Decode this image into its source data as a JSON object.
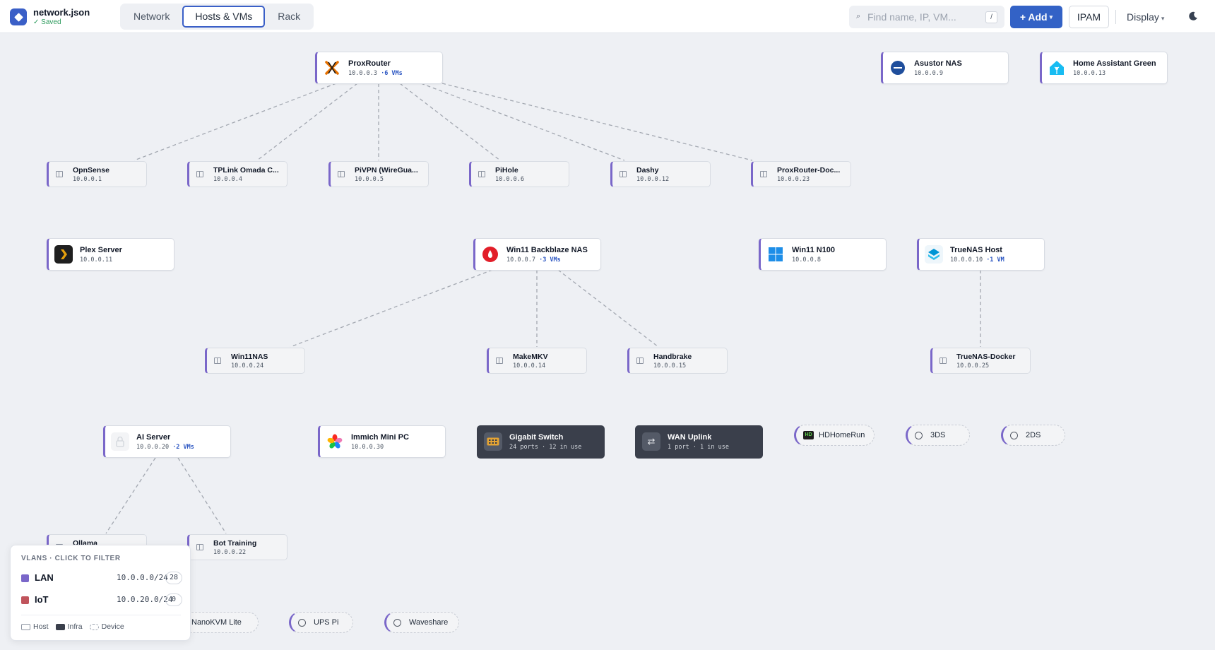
{
  "app": {
    "file_name": "network.json",
    "save_status": "✓ Saved"
  },
  "tabs": [
    {
      "label": "Network",
      "active": false
    },
    {
      "label": "Hosts & VMs",
      "active": true
    },
    {
      "label": "Rack",
      "active": false
    }
  ],
  "search": {
    "placeholder": "Find name, IP, VM...",
    "shortcut": "/"
  },
  "toolbar": {
    "add_label": "+ Add",
    "add_caret": "▾",
    "ipam_label": "IPAM",
    "display_label": "Display",
    "display_caret": "▾",
    "theme_icon": "moon-icon"
  },
  "hosts": [
    {
      "name": "ProxRouter",
      "ip": "10.0.0.3",
      "vms": "·6 VMs",
      "icon": "proxmox-icon"
    },
    {
      "name": "Asustor NAS",
      "ip": "10.0.0.9",
      "vms": "",
      "icon": "asustor-icon"
    },
    {
      "name": "Home Assistant Green",
      "ip": "10.0.0.13",
      "vms": "",
      "icon": "home-assistant-icon"
    },
    {
      "name": "Plex Server",
      "ip": "10.0.0.11",
      "vms": "",
      "icon": "plex-icon"
    },
    {
      "name": "Win11 Backblaze NAS",
      "ip": "10.0.0.7",
      "vms": "·3 VMs",
      "icon": "backblaze-icon"
    },
    {
      "name": "Win11 N100",
      "ip": "10.0.0.8",
      "vms": "",
      "icon": "windows-icon"
    },
    {
      "name": "TrueNAS Host",
      "ip": "10.0.0.10",
      "vms": "·1 VM",
      "icon": "truenas-icon"
    },
    {
      "name": "AI Server",
      "ip": "10.0.0.20",
      "vms": "·2 VMs",
      "icon": "lock-icon"
    },
    {
      "name": "Immich Mini PC",
      "ip": "10.0.0.30",
      "vms": "",
      "icon": "immich-icon"
    }
  ],
  "vms": [
    {
      "name": "OpnSense",
      "ip": "10.0.0.1"
    },
    {
      "name": "TPLink Omada C...",
      "ip": "10.0.0.4"
    },
    {
      "name": "PiVPN (WireGua...",
      "ip": "10.0.0.5"
    },
    {
      "name": "PiHole",
      "ip": "10.0.0.6"
    },
    {
      "name": "Dashy",
      "ip": "10.0.0.12"
    },
    {
      "name": "ProxRouter-Doc...",
      "ip": "10.0.0.23"
    },
    {
      "name": "Win11NAS",
      "ip": "10.0.0.24"
    },
    {
      "name": "MakeMKV",
      "ip": "10.0.0.14"
    },
    {
      "name": "Handbrake",
      "ip": "10.0.0.15"
    },
    {
      "name": "TrueNAS-Docker",
      "ip": "10.0.0.25"
    },
    {
      "name": "Ollama",
      "ip": ""
    },
    {
      "name": "Bot Training",
      "ip": "10.0.0.22"
    }
  ],
  "infra": [
    {
      "name": "Gigabit Switch",
      "sub": "24 ports · 12 in use",
      "icon": "switch-icon"
    },
    {
      "name": "WAN Uplink",
      "sub": "1 port · 1 in use",
      "icon": "swap-arrows-icon"
    }
  ],
  "devices": [
    {
      "name": "HDHomeRun",
      "icon": "hd-icon"
    },
    {
      "name": "3DS",
      "icon": "circle-icon"
    },
    {
      "name": "2DS",
      "icon": "circle-icon"
    },
    {
      "name": "NanoKVM Lite",
      "icon": "circle-icon"
    },
    {
      "name": "UPS Pi",
      "icon": "circle-icon"
    },
    {
      "name": "Waveshare",
      "icon": "circle-icon"
    }
  ],
  "vlans": {
    "title": "VLANS · CLICK TO FILTER",
    "items": [
      {
        "name": "LAN",
        "subnet": "10.0.0.0/24",
        "count": "28",
        "color": "#7a67c9"
      },
      {
        "name": "IoT",
        "subnet": "10.0.20.0/24",
        "count": "0",
        "color": "#c0545c"
      }
    ],
    "legend": {
      "host": "Host",
      "infra": "Infra",
      "device": "Device"
    }
  },
  "colors": {
    "accent": "#3362c6",
    "vlan_lan": "#7a67c9",
    "edge": "#a3a8b1"
  }
}
